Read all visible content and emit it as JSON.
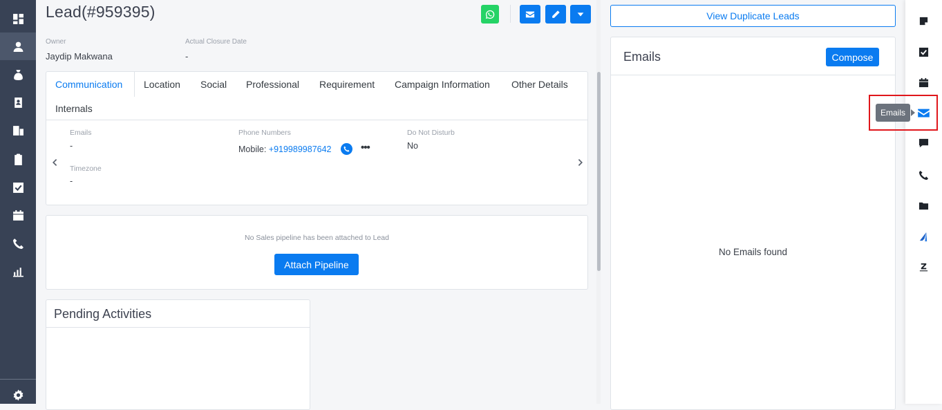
{
  "lead": {
    "title": "Lead(#959395)",
    "owner_label": "Owner",
    "owner_value": "Jaydip Makwana",
    "closure_label": "Actual Closure Date",
    "closure_value": "-"
  },
  "tabs": [
    {
      "label": "Communication"
    },
    {
      "label": "Location"
    },
    {
      "label": "Social"
    },
    {
      "label": "Professional"
    },
    {
      "label": "Requirement"
    },
    {
      "label": "Campaign Information"
    },
    {
      "label": "Other Details"
    },
    {
      "label": "Internals"
    }
  ],
  "communication": {
    "emails_label": "Emails",
    "emails_value": "-",
    "phone_label": "Phone Numbers",
    "phone_prefix": "Mobile: ",
    "phone_number": "+919989987642",
    "dnd_label": "Do Not Disturb",
    "dnd_value": "No",
    "timezone_label": "Timezone",
    "timezone_value": "-"
  },
  "pipeline": {
    "message": "No Sales pipeline has been attached to Lead",
    "button": "Attach Pipeline"
  },
  "pending": {
    "title": "Pending Activities"
  },
  "right": {
    "duplicate_button": "View Duplicate Leads",
    "emails_title": "Emails",
    "compose_button": "Compose",
    "empty_message": "No Emails found"
  },
  "tooltip": {
    "text": "Emails"
  },
  "icons": {
    "leftnav": [
      "dashboard-icon",
      "user-icon",
      "money-bag-icon",
      "contact-card-icon",
      "building-icon",
      "clipboard-icon",
      "check-square-icon",
      "calendar-icon",
      "phone-icon",
      "chart-icon",
      "settings-icon"
    ],
    "rightbar": [
      "note-icon",
      "task-check-icon",
      "calendar-icon",
      "envelope-icon",
      "comment-icon",
      "phone-icon",
      "folder-icon",
      "integration-icon",
      "zendesk-icon"
    ]
  },
  "colors": {
    "primary": "#0a7bf0",
    "whatsapp": "#25d366",
    "sidebar": "#384255",
    "highlight": "#e0161b"
  }
}
